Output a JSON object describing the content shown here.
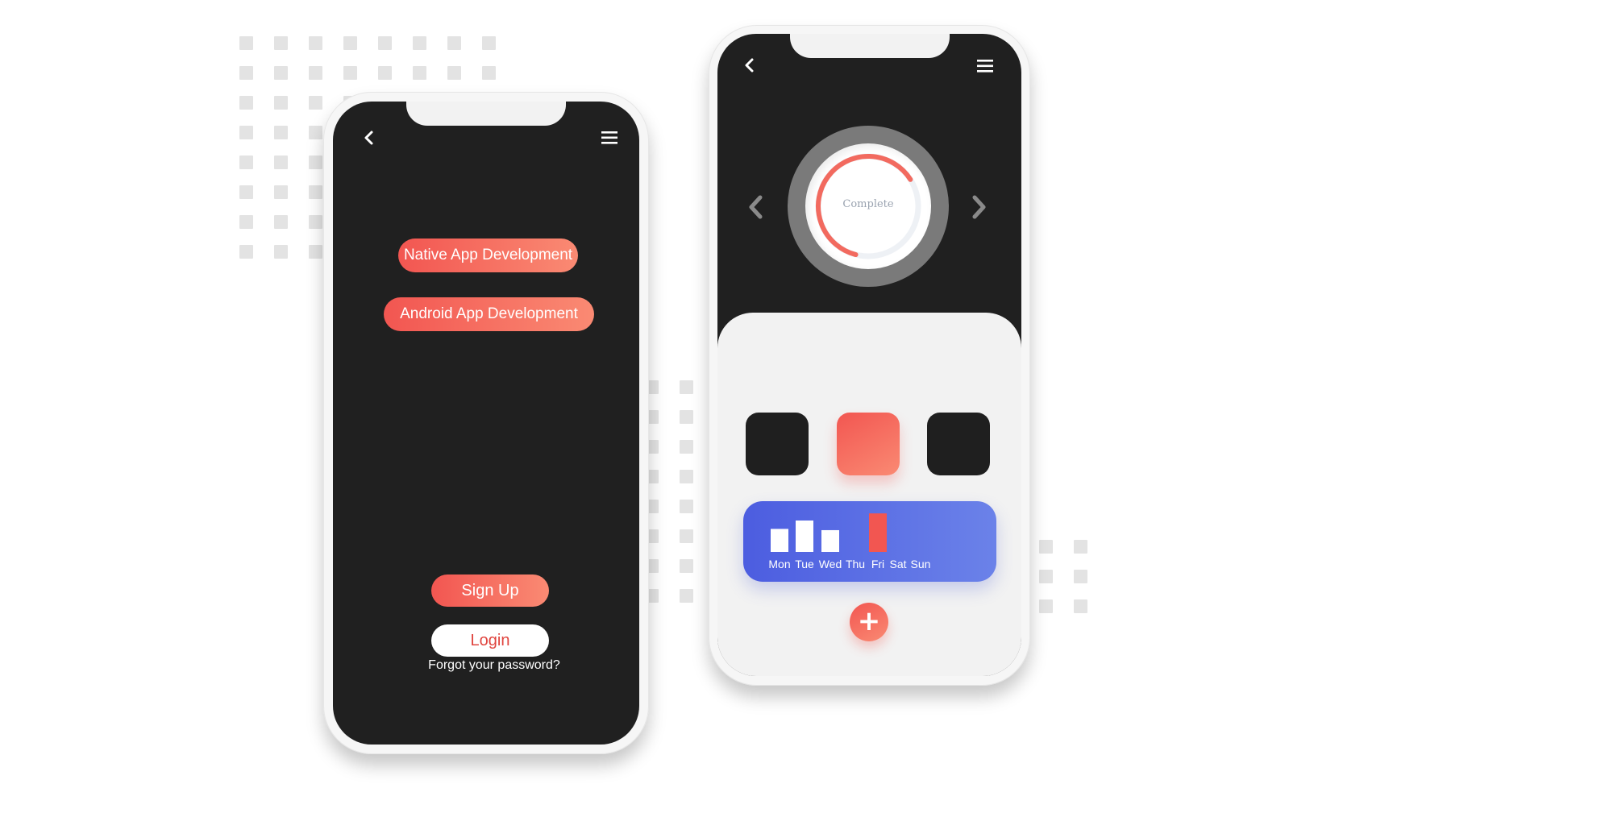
{
  "left_phone": {
    "back_icon": "chevron-left-icon",
    "menu_icon": "hamburger-menu-icon",
    "tags": [
      "Native App Development",
      "Android App Development"
    ],
    "signup_label": "Sign Up",
    "login_label": "Login",
    "forgot_label": "Forgot your password?"
  },
  "right_phone": {
    "back_icon": "chevron-left-icon",
    "menu_icon": "hamburger-menu-icon",
    "gauge_label": "Complete",
    "gauge_progress": 0.62,
    "prev_icon": "chevron-left-icon",
    "next_icon": "chevron-right-icon",
    "selected_tile_index": 1,
    "plus_label": "+",
    "week": {
      "days": [
        "Mon",
        "Tue",
        "Wed",
        "Thu",
        "Fri",
        "Sat",
        "Sun"
      ],
      "levels": [
        0.55,
        0.75,
        0.52,
        0,
        0.92,
        0,
        0
      ],
      "highlight_index": 4
    }
  },
  "colors": {
    "accent": "#f25651",
    "accent_light": "#fa8a73",
    "dark": "#202020",
    "panel": "#f2f2f2",
    "card_blue": "#5869e4"
  }
}
